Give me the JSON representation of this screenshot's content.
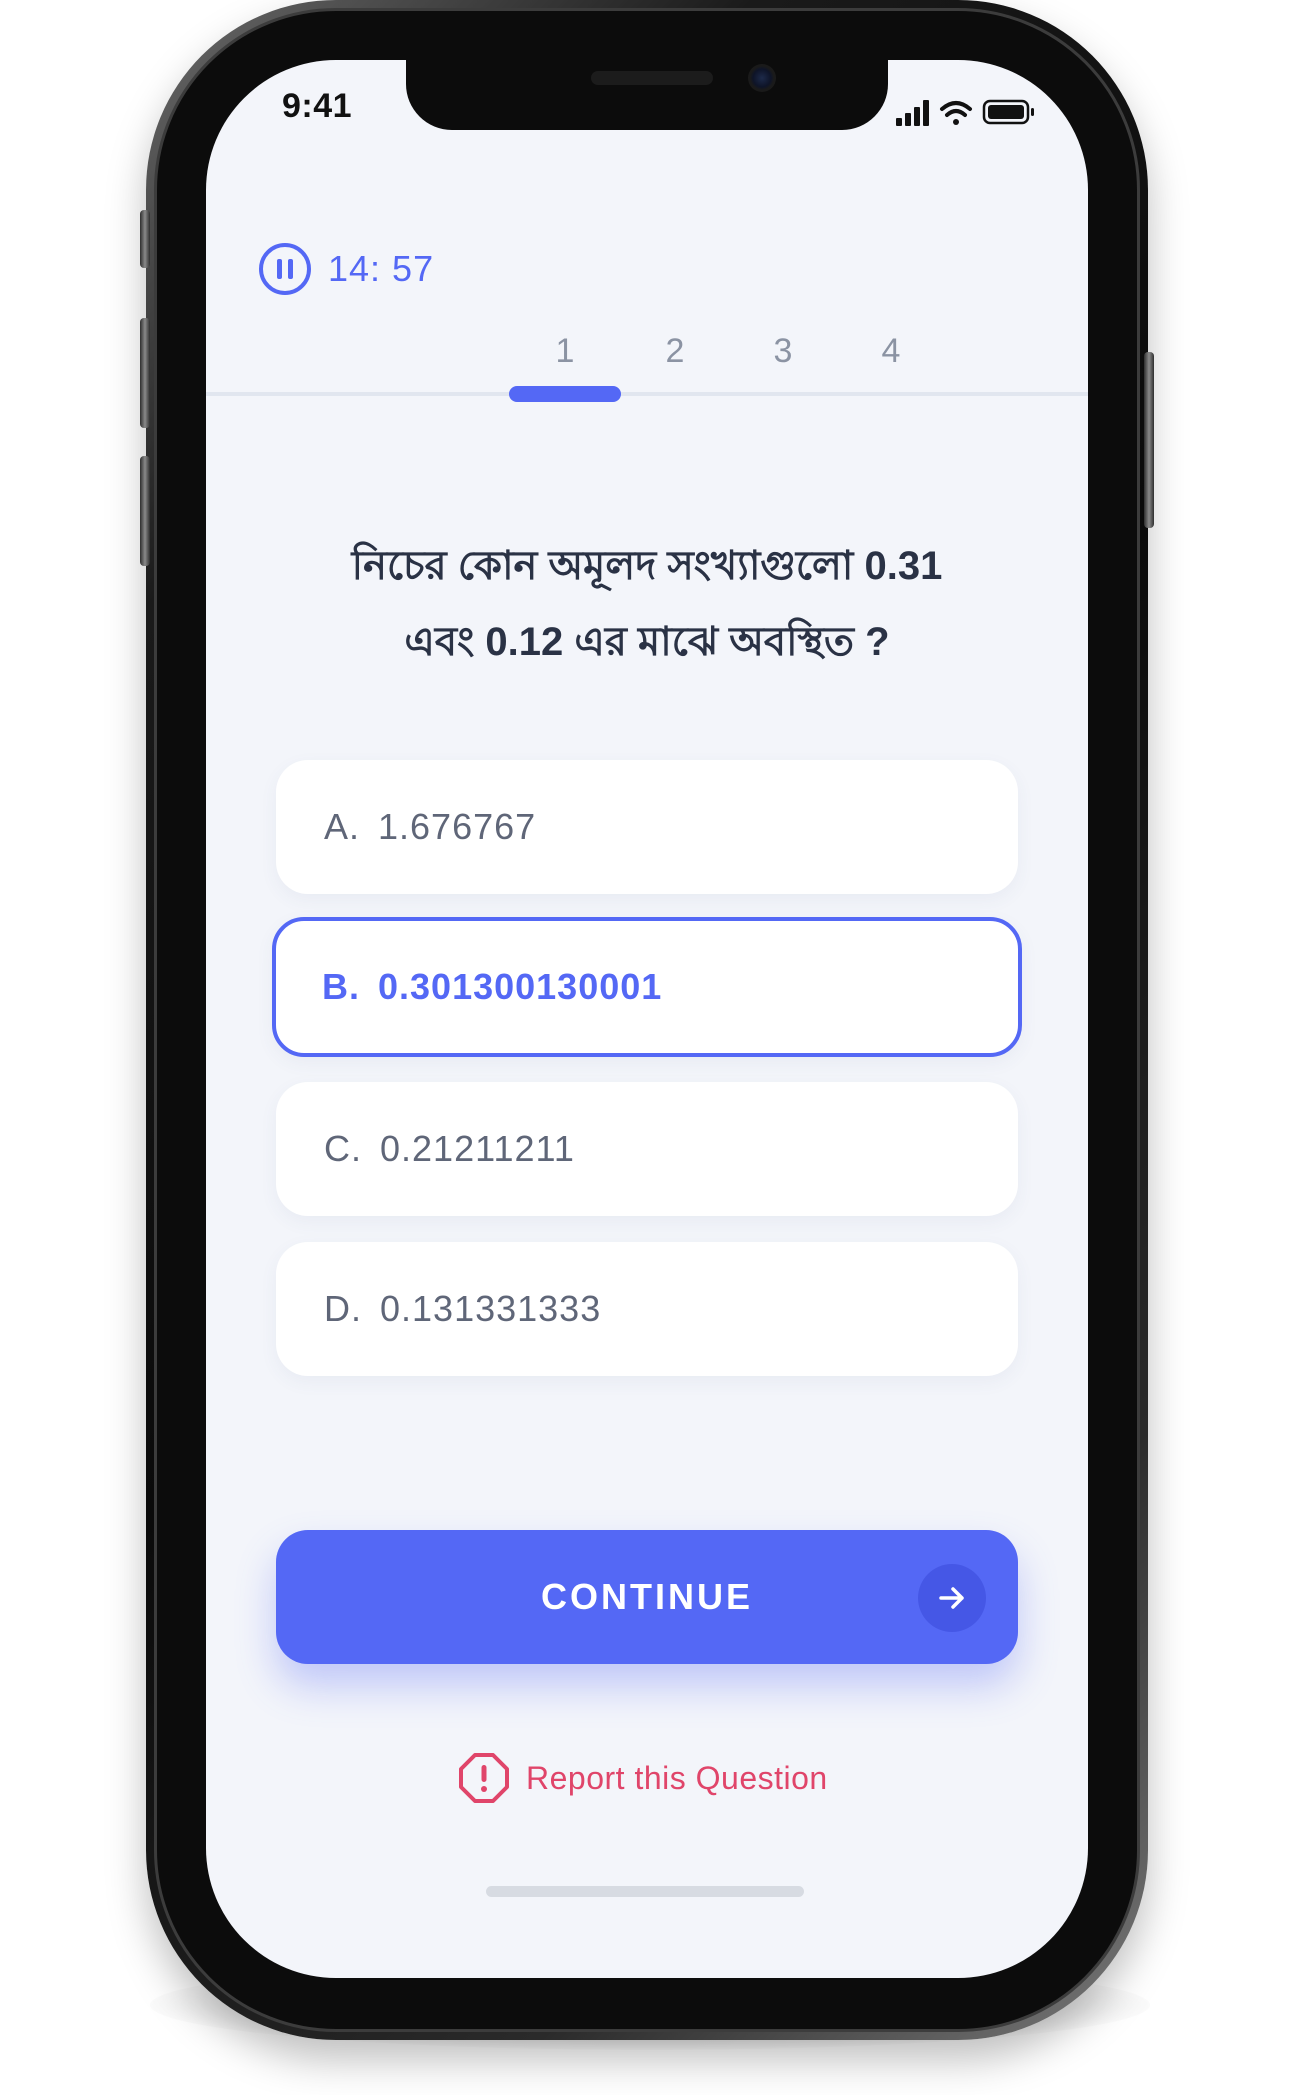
{
  "status_bar": {
    "time": "9:41",
    "icons": [
      "signal-icon",
      "wifi-icon",
      "battery-icon"
    ]
  },
  "timer": {
    "icon": "pause-icon",
    "text": "14: 57"
  },
  "steps": {
    "items": [
      "1",
      "2",
      "3",
      "4"
    ],
    "active": "1"
  },
  "question": {
    "line1": "নিচের কোন অমূলদ সংখ্যাগুলো 0.31",
    "line2": "এবং 0.12 এর মাঝে অবস্থিত ?"
  },
  "options": [
    {
      "letter": "A.",
      "value": "1.676767",
      "selected": false
    },
    {
      "letter": "B.",
      "value": "0.301300130001",
      "selected": true
    },
    {
      "letter": "C.",
      "value": "0.21211211",
      "selected": false
    },
    {
      "letter": "D.",
      "value": "0.131331333",
      "selected": false
    }
  ],
  "continue_button": {
    "label": "CONTINUE",
    "icon": "arrow-right-icon"
  },
  "report": {
    "icon": "alert-octagon-icon",
    "label": "Report this Question"
  },
  "colors": {
    "accent": "#5468f5",
    "danger": "#e0456a",
    "background": "#f3f5fa",
    "text": "#2a3245"
  }
}
